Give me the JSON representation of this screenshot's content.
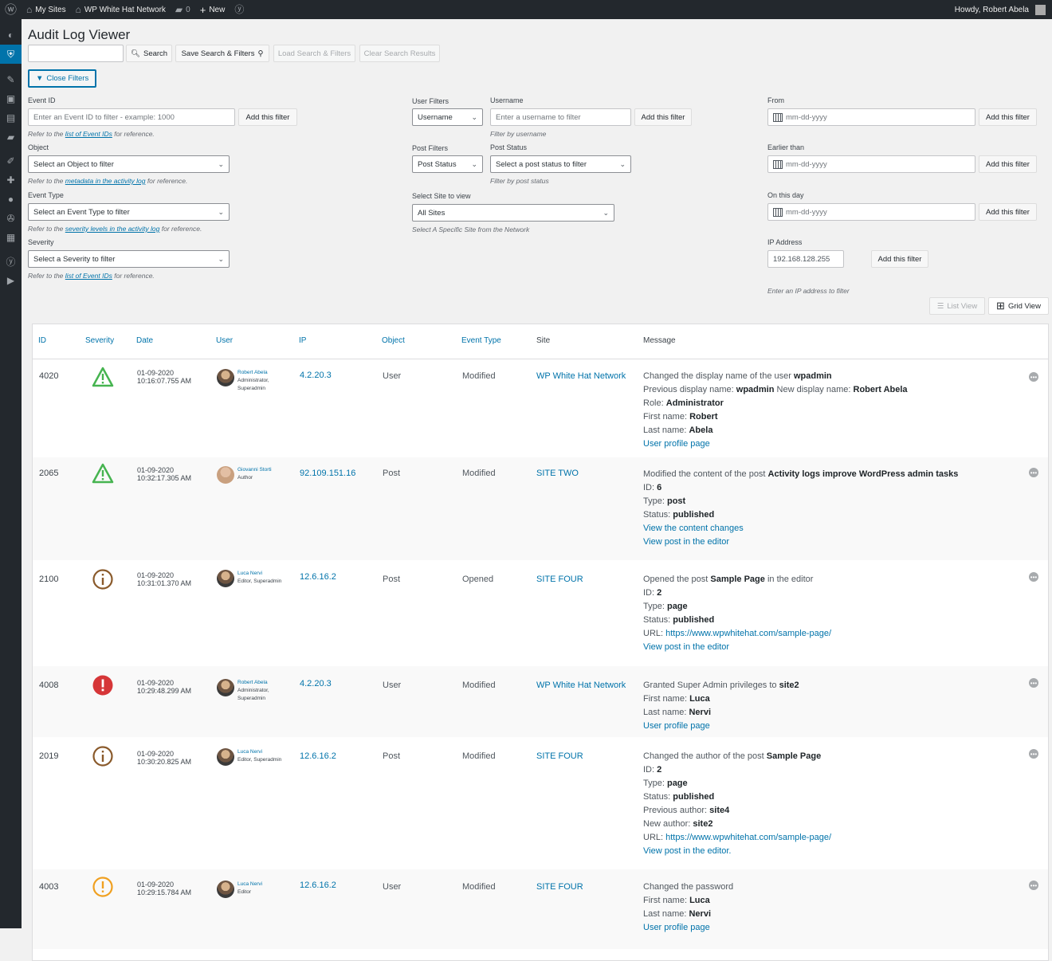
{
  "adminbar": {
    "my_sites": "My Sites",
    "network": "WP White Hat Network",
    "comments": "0",
    "new": "New",
    "howdy": "Howdy, Robert Abela"
  },
  "page": {
    "title": "Audit Log Viewer"
  },
  "search": {
    "placeholder": "",
    "search_btn": "Search",
    "save_btn": "Save Search & Filters",
    "load_btn": "Load Search & Filters",
    "clear_btn": "Clear Search Results",
    "close_filters": "Close Filters"
  },
  "filters": {
    "event_id_label": "Event ID",
    "event_id_placeholder": "Enter an Event ID to filter - example: 1000",
    "add": "Add this filter",
    "refer_to": "Refer to the",
    "for_ref": "for reference.",
    "list_link": "list of Event IDs",
    "metadata_link": "metadata in the activity log",
    "severity_link": "severity levels in the activity log",
    "object_label": "Object",
    "object_select": "Select an Object to filter",
    "event_type_label": "Event Type",
    "event_type_select": "Select an Event Type to filter",
    "severity_label": "Severity",
    "severity_select": "Select a Severity to filter",
    "user_filters_label": "User Filters",
    "user_filter_select": "Username",
    "username_label": "Username",
    "username_placeholder": "Enter a username to filter",
    "username_hint": "Filter by username",
    "post_filters_label": "Post Filters",
    "post_filter_select": "Post Status",
    "post_status_label": "Post Status",
    "post_status_select": "Select a post status to filter",
    "post_status_hint": "Filter by post status",
    "site_label": "Select Site to view",
    "site_select": "All Sites",
    "site_hint": "Select A Specific Site from the Network",
    "from_label": "From",
    "earlier_label": "Earlier than",
    "on_day_label": "On this day",
    "date_placeholder": "mm-dd-yyyy",
    "ip_label": "IP Address",
    "ip_value": "192.168.128.255",
    "ip_hint": "Enter an IP address to filter",
    "list_view": "List View",
    "grid_view": "Grid View"
  },
  "table": {
    "headers": {
      "id": "ID",
      "severity": "Severity",
      "date": "Date",
      "user": "User",
      "ip": "IP",
      "object": "Object",
      "event_type": "Event Type",
      "site": "Site",
      "message": "Message"
    },
    "rows": [
      {
        "id": "4020",
        "severity": "warning",
        "date": "01-09-2020",
        "time": "10:16:07.755 AM",
        "user": "Robert Abela",
        "role1": "Administrator,",
        "role2": "Superadmin",
        "ip": "4.2.20.3",
        "object": "User",
        "event": "Modified",
        "site": "WP White Hat Network",
        "m1a": "Changed the display name of the user ",
        "m1b": "wpadmin",
        "m2a": "Previous display name: ",
        "m2b": "wpadmin",
        "m2c": " New display name: ",
        "m2d": "Robert Abela",
        "m3a": "Role: ",
        "m3b": "Administrator",
        "m4a": "First name: ",
        "m4b": "Robert",
        "m5a": "Last name: ",
        "m5b": "Abela",
        "link1": "User profile page"
      },
      {
        "id": "2065",
        "severity": "warning",
        "date": "01-09-2020",
        "time": "10:32:17.305 AM",
        "user": "Giovanni Storti",
        "role1": "Author",
        "role2": "",
        "ip": "92.109.151.16",
        "object": "Post",
        "event": "Modified",
        "site": "SITE TWO",
        "m1a": "Modified the content of the post ",
        "m1b": "Activity logs improve WordPress admin tasks",
        "m2a": "ID: ",
        "m2b": "6",
        "m3a": "Type: ",
        "m3b": "post",
        "m4a": "Status: ",
        "m4b": "published",
        "link1": "View the content changes",
        "link2": "View post in the editor"
      },
      {
        "id": "2100",
        "severity": "info",
        "date": "01-09-2020",
        "time": "10:31:01.370 AM",
        "user": "Luca Nervi",
        "role1": "Editor, Superadmin",
        "role2": "",
        "ip": "12.6.16.2",
        "object": "Post",
        "event": "Opened",
        "site": "SITE FOUR",
        "m1a": "Opened the post ",
        "m1b": "Sample Page",
        "m1c": " in the editor",
        "m2a": "ID: ",
        "m2b": "2",
        "m3a": "Type: ",
        "m3b": "page",
        "m4a": "Status: ",
        "m4b": "published",
        "m5a": "URL: ",
        "m5link": "https://www.wpwhitehat.com/sample-page/",
        "link1": "View post in the editor"
      },
      {
        "id": "4008",
        "severity": "critical",
        "date": "01-09-2020",
        "time": "10:29:48.299 AM",
        "user": "Robert Abela",
        "role1": "Administrator,",
        "role2": "Superadmin",
        "ip": "4.2.20.3",
        "object": "User",
        "event": "Modified",
        "site": "WP White Hat Network",
        "m1a": "Granted Super Admin privileges to ",
        "m1b": "site2",
        "m2a": "First name: ",
        "m2b": "Luca",
        "m3a": "Last name: ",
        "m3b": "Nervi",
        "link1": "User profile page"
      },
      {
        "id": "2019",
        "severity": "info",
        "date": "01-09-2020",
        "time": "10:30:20.825 AM",
        "user": "Luca Nervi",
        "role1": "Editor, Superadmin",
        "role2": "",
        "ip": "12.6.16.2",
        "object": "Post",
        "event": "Modified",
        "site": "SITE FOUR",
        "m1a": "Changed the author of the post ",
        "m1b": "Sample Page",
        "m2a": "ID: ",
        "m2b": "2",
        "m3a": "Type: ",
        "m3b": "page",
        "m4a": "Status: ",
        "m4b": "published",
        "m5a": "Previous author: ",
        "m5b": "site4",
        "m6a": "New author: ",
        "m6b": "site2",
        "m7a": "URL: ",
        "m7link": "https://www.wpwhitehat.com/sample-page/",
        "link1": "View post in the editor."
      },
      {
        "id": "4003",
        "severity": "medium",
        "date": "01-09-2020",
        "time": "10:29:15.784 AM",
        "user": "Luca Nervi",
        "role1": "Editor",
        "role2": "",
        "ip": "12.6.16.2",
        "object": "User",
        "event": "Modified",
        "site": "SITE FOUR",
        "m1a": "Changed the password",
        "m2a": "First name: ",
        "m2b": "Luca",
        "m3a": "Last name: ",
        "m3b": "Nervi",
        "link1": "User profile page"
      }
    ]
  },
  "colors": {
    "link": "#0073aa",
    "warning": "#46b450",
    "info": "#8a5a2b",
    "critical": "#d63638",
    "medium": "#f0a020"
  }
}
